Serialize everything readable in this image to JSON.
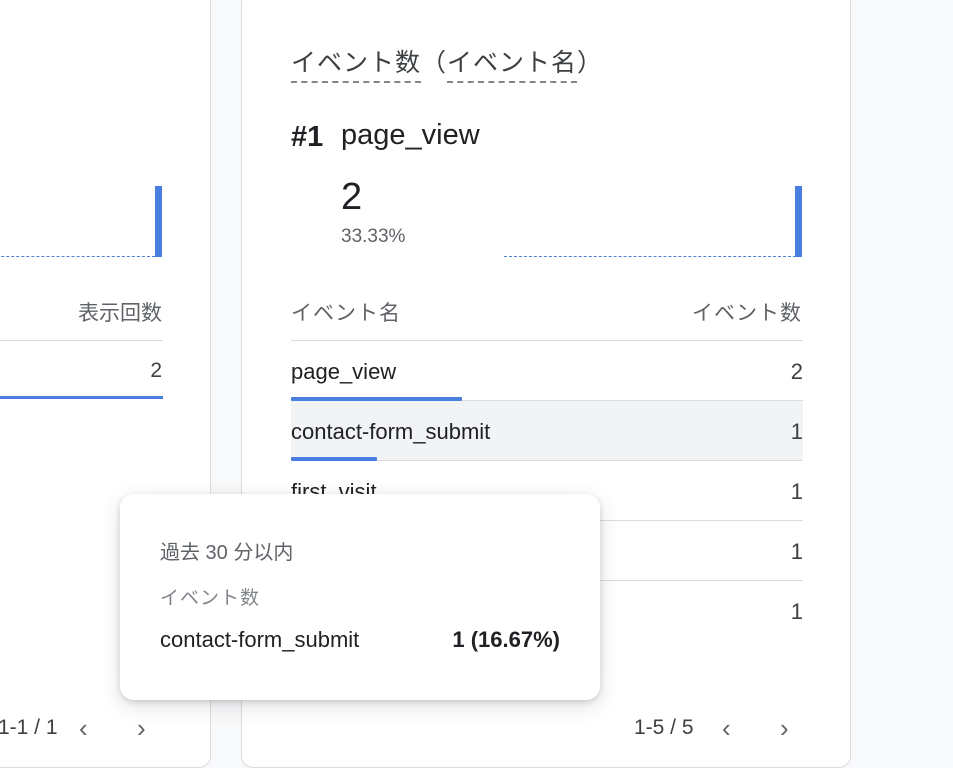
{
  "left_card": {
    "column_header": "表示回数",
    "row_value": "2",
    "pagination": "1-1 / 1"
  },
  "right_card": {
    "title_metric": "イベント数",
    "title_dimension": "イベント名",
    "title_paren_open": "（",
    "title_paren_close": "）",
    "top_item": {
      "rank": "#1",
      "name": "page_view",
      "value": "2",
      "percent": "33.33%"
    },
    "table": {
      "header_name": "イベント名",
      "header_count": "イベント数",
      "rows": [
        {
          "name": "page_view",
          "value": "2",
          "share": 1.0
        },
        {
          "name": "contact-form_submit",
          "value": "1",
          "share": 0.5
        },
        {
          "name": "first_visit",
          "value": "1",
          "share": 0.5
        },
        {
          "name": "",
          "value": "1",
          "share": 0.5
        },
        {
          "name": "",
          "value": "1",
          "share": 0.5
        }
      ]
    },
    "pagination": "1-5 / 5"
  },
  "tooltip": {
    "time_range": "過去 30 分以内",
    "metric": "イベント数",
    "event_name": "contact-form_submit",
    "event_value": "1 (16.67%)"
  },
  "icons": {
    "prev": "‹",
    "next": "›"
  },
  "colors": {
    "accent_blue": "#4a7ee0",
    "row_highlight": "#f1f3f4"
  }
}
